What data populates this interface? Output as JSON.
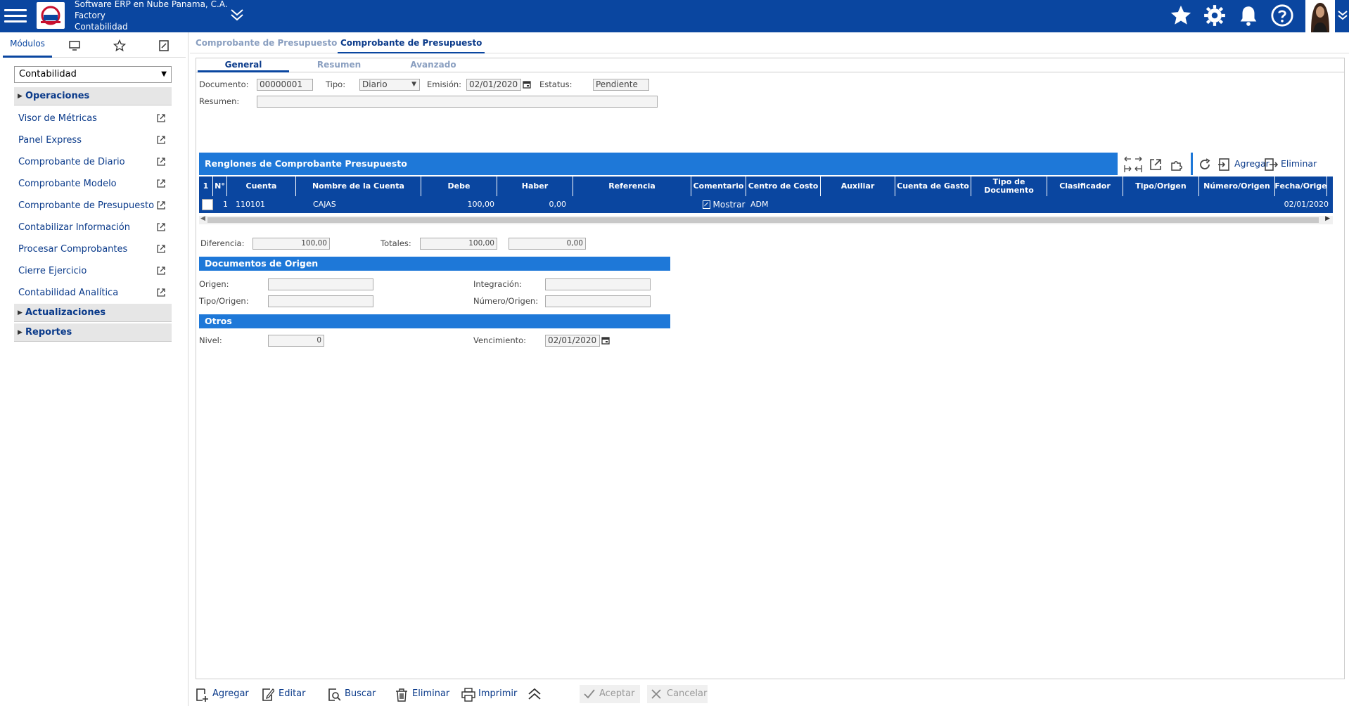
{
  "header": {
    "company": "Software ERP en Nube Panama, C.A.",
    "site": "Factory",
    "module": "Contabilidad"
  },
  "left_panel": {
    "tabs": [
      "Módulos"
    ],
    "module_select": "Contabilidad",
    "sections": {
      "operaciones": "Operaciones",
      "actualizaciones": "Actualizaciones",
      "reportes": "Reportes"
    },
    "items": [
      "Visor de Métricas",
      "Panel Express",
      "Comprobante de Diario",
      "Comprobante Modelo",
      "Comprobante de Presupuesto",
      "Contabilizar Información",
      "Procesar Comprobantes",
      "Cierre Ejercicio",
      "Contabilidad Analítica"
    ]
  },
  "doc_tabs": [
    "Comprobante de Presupuesto",
    "Comprobante de Presupuesto"
  ],
  "sub_tabs": [
    "General",
    "Resumen",
    "Avanzado"
  ],
  "form": {
    "documento_label": "Documento:",
    "documento": "00000001",
    "tipo_label": "Tipo:",
    "tipo": "Diario",
    "emision_label": "Emisión:",
    "emision": "02/01/2020",
    "estatus_label": "Estatus:",
    "estatus": "Pendiente",
    "resumen_label": "Resumen:",
    "resumen": ""
  },
  "grid": {
    "title": "Renglones de Comprobante Presupuesto",
    "tools": {
      "add": "Agregar",
      "delete": "Eliminar"
    },
    "columns": [
      "1",
      "N°",
      "Cuenta",
      "Nombre de la Cuenta",
      "Debe",
      "Haber",
      "Referencia",
      "Comentario",
      "Centro de Costo",
      "Auxiliar",
      "Cuenta de Gasto",
      "Tipo de Documento",
      "Clasificador",
      "Tipo/Origen",
      "Número/Origen",
      "Fecha/Orige"
    ],
    "rows": [
      {
        "n": "1",
        "cuenta": "110101",
        "nombre": "CAJAS",
        "debe": "100,00",
        "haber": "0,00",
        "referencia": "",
        "comentario": "Mostrar",
        "centro": "ADM",
        "fecha": "02/01/2020"
      }
    ]
  },
  "totals": {
    "diferencia_label": "Diferencia:",
    "diferencia": "100,00",
    "totales_label": "Totales:",
    "debe": "100,00",
    "haber": "0,00"
  },
  "origen": {
    "title": "Documentos de Origen",
    "origen_label": "Origen:",
    "integracion_label": "Integración:",
    "tipo_origen_label": "Tipo/Origen:",
    "numero_origen_label": "Número/Origen:"
  },
  "otros": {
    "title": "Otros",
    "nivel_label": "Nivel:",
    "nivel": "0",
    "vencimiento_label": "Vencimiento:",
    "vencimiento": "02/01/2020"
  },
  "bottom": {
    "agregar": "Agregar",
    "editar": "Editar",
    "buscar": "Buscar",
    "eliminar": "Eliminar",
    "imprimir": "Imprimir",
    "aceptar": "Aceptar",
    "cancelar": "Cancelar"
  },
  "colors": {
    "primary": "#0a46a0",
    "section": "#1e78d8"
  }
}
